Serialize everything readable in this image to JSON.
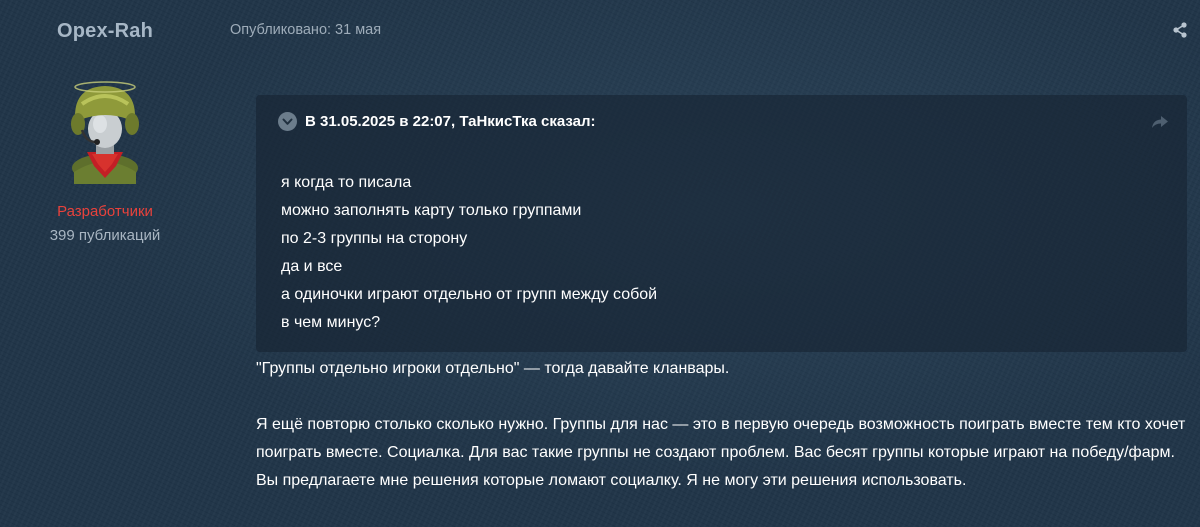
{
  "author": {
    "name": "Opex-Rah",
    "group": "Разработчики",
    "posts": "399 публикаций",
    "avatar_icon": "tank-helmet-avatar"
  },
  "post": {
    "meta": "Опубликовано: 31 мая",
    "share_icon": "share-icon"
  },
  "quote": {
    "header": "В 31.05.2025 в 22:07, ТаНкисТка сказал:",
    "toggle_icon": "chevron-down-icon",
    "jump_icon": "reply-arrow-icon",
    "lines": [
      "я когда то писала",
      "можно заполнять карту только группами",
      "по 2-3 группы на сторону",
      "да и все",
      "а одиночки играют отдельно от групп между собой",
      "в чем минус?"
    ]
  },
  "body": {
    "paragraphs": [
      "\"Группы отдельно игроки отдельно\" — тогда давайте кланвары.",
      "Я ещё повторю столько сколько нужно. Группы для нас — это в первую очередь возможность поиграть вместе тем кто хочет поиграть вместе. Социалка. Для вас такие группы не создают проблем. Вас бесят группы которые играют на победу/фарм. Вы предлагаете мне решения которые ломают социалку. Я не могу эти решения использовать."
    ]
  },
  "colors": {
    "background": "#203548",
    "author_name": "#a7b7c6",
    "group": "#e8423c",
    "muted": "#9eacb9",
    "quote_bg": "#162432"
  }
}
